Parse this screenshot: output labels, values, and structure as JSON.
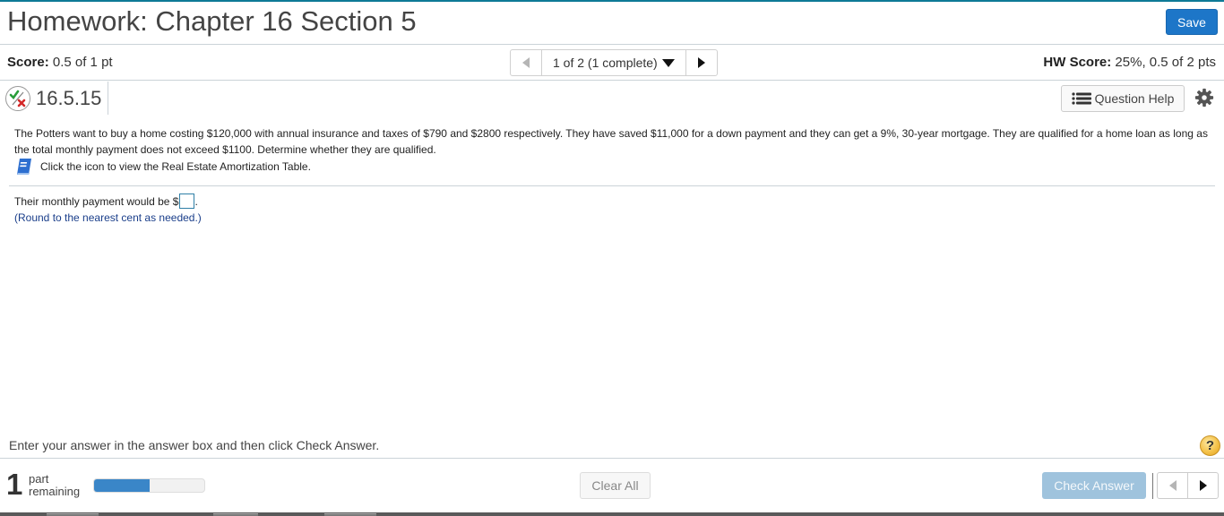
{
  "header": {
    "title": "Homework: Chapter 16 Section 5",
    "save_label": "Save"
  },
  "scorebar": {
    "score_label": "Score:",
    "score_value": "0.5 of 1 pt",
    "pager_text": "1 of 2 (1 complete)",
    "hw_score_label": "HW Score:",
    "hw_score_value": "25%, 0.5 of 2 pts"
  },
  "question": {
    "number": "16.5.15",
    "status_icon": "partial-credit-icon",
    "help_label": "Question Help",
    "text": "The Potters want to buy a home costing $120,000 with annual insurance and taxes of $790 and $2800 respectively. They have saved $11,000 for a down payment and they can get a 9%, 30-year mortgage. They are qualified for a home loan as long as the total monthly payment does not exceed $1100. Determine whether they are qualified.",
    "table_link_text": "Click the icon to view the Real Estate Amortization Table.",
    "answer_prefix": "Their monthly payment would be $",
    "answer_value": "",
    "answer_suffix": ".",
    "round_note": "(Round to the nearest cent as needed.)"
  },
  "footer": {
    "instruction": "Enter your answer in the answer box and then click Check Answer.",
    "help_symbol": "?",
    "parts_count": "1",
    "parts_label_1": "part",
    "parts_label_2": "remaining",
    "progress_fraction": 0.5,
    "clear_label": "Clear All",
    "check_label": "Check Answer"
  },
  "colors": {
    "accent": "#1d76c8",
    "top_border": "#0e7a96",
    "progress_fill": "#3a86c8",
    "check_disabled": "#9fc3dd",
    "note_text": "#1a3e8a"
  }
}
